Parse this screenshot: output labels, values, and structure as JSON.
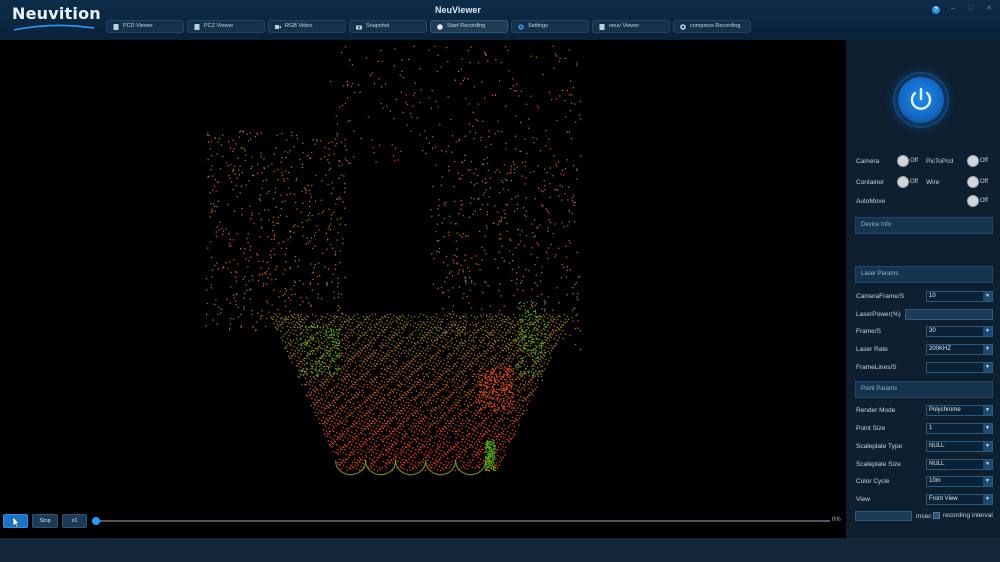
{
  "app": {
    "logo": "Neuvition",
    "title": "NeuViewer"
  },
  "tabs": [
    {
      "label": "PCD Viewer",
      "icon": "file-icon"
    },
    {
      "label": "PCZ Viewer",
      "icon": "file-icon"
    },
    {
      "label": "RGB Video",
      "icon": "video-icon"
    },
    {
      "label": "Snapshot",
      "icon": "camera-icon"
    },
    {
      "label": "Start Recording",
      "icon": "record-icon"
    },
    {
      "label": "Settings",
      "icon": "gear-icon"
    },
    {
      "label": "neuv Viewer",
      "icon": "file-icon"
    },
    {
      "label": "compress Recording",
      "icon": "compress-icon"
    }
  ],
  "playback": {
    "play_label": "",
    "stop_label": "Stop",
    "speed_label": "x1",
    "progress_text": "0%",
    "progress_value": 0
  },
  "panel": {
    "toggles": [
      {
        "label": "Camera",
        "state": "Off"
      },
      {
        "label": "PicToPcd",
        "state": "Off"
      },
      {
        "label": "Container",
        "state": "Off"
      },
      {
        "label": "Wire",
        "state": "Off"
      },
      {
        "label": "AutoMove",
        "state": "Off"
      }
    ],
    "sections": {
      "device_info": "Device Info",
      "laser_params": "Laser Params",
      "point_params": "Point Params"
    },
    "laser_fields": [
      {
        "label": "CameraFrame/S",
        "value": "10"
      },
      {
        "label": "LaserPower(%)",
        "value": ""
      },
      {
        "label": "Frame/S",
        "value": "30"
      },
      {
        "label": "Laser Rate",
        "value": "200KHZ"
      },
      {
        "label": "FrameLines/S",
        "value": ""
      }
    ],
    "point_fields": [
      {
        "label": "Render Mode",
        "value": "Polychrome"
      },
      {
        "label": "Point Size",
        "value": "1"
      },
      {
        "label": "Scaleplate Type",
        "value": "NULL"
      },
      {
        "label": "Scaleplate Size",
        "value": "NULL"
      },
      {
        "label": "Color Cycle",
        "value": "10m"
      },
      {
        "label": "View",
        "value": "Front View"
      }
    ],
    "recording": {
      "unit": "msec",
      "checkbox_label": "recording interval"
    }
  },
  "colors": {
    "accent": "#1aa0ff",
    "title_bg": "#0d2d4a",
    "panel_bg": "#0e1f2f"
  }
}
